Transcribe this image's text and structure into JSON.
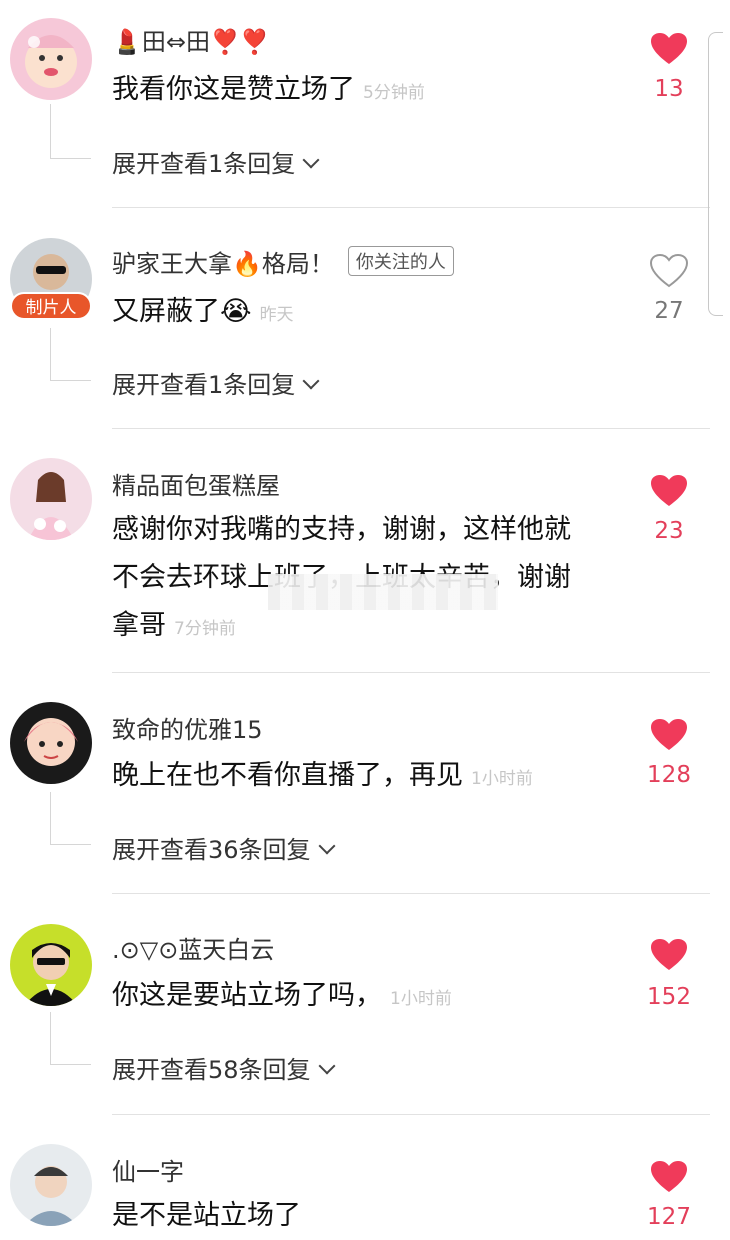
{
  "comments": [
    {
      "name": "💄田⇔田❣️❣️",
      "text": "我看你这是赞立场了",
      "time": "5分钟前",
      "likes": "13",
      "liked": true,
      "expand": "展开查看1条回复"
    },
    {
      "name": "驴家王大拿🔥格局！",
      "tag": "你关注的人",
      "badge": "制片人",
      "text": "又屏蔽了😭",
      "time": "昨天",
      "likes": "27",
      "liked": false,
      "expand": "展开查看1条回复"
    },
    {
      "name": "精品面包蛋糕屋",
      "text_lines": [
        "感谢你对我嘴的支持，谢谢，这样他就",
        "不会去环球上班了，上班太辛苦，谢谢",
        "拿哥"
      ],
      "time": "7分钟前",
      "likes": "23",
      "liked": true
    },
    {
      "name": "致命的优雅15",
      "text": "晚上在也不看你直播了，再见",
      "time": "1小时前",
      "likes": "128",
      "liked": true,
      "expand": "展开查看36条回复"
    },
    {
      "name": ".⊙▽⊙蓝天白云",
      "text": "你这是要站立场了吗，",
      "time": "1小时前",
      "likes": "152",
      "liked": true,
      "expand": "展开查看58条回复"
    },
    {
      "name": "仙一字",
      "text": "是不是站立场了",
      "likes": "127",
      "liked": true
    }
  ],
  "colors": {
    "heart_liked": "#f03a5a",
    "heart_outline": "#999999",
    "badge": "#e8562a"
  },
  "icons": [
    "heart-icon",
    "heart-outline-icon",
    "chevron-down-icon"
  ]
}
